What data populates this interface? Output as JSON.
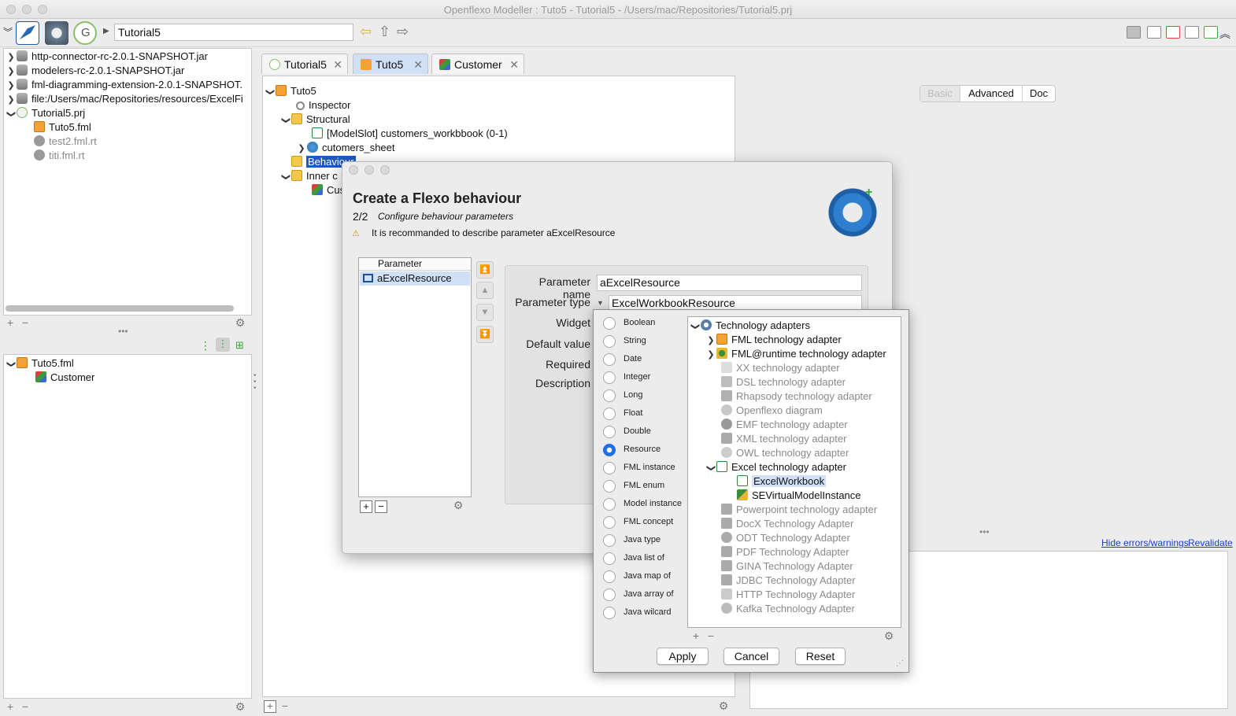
{
  "window": {
    "title": "Openflexo Modeller : Tuto5 - Tutorial5 - /Users/mac/Repositories/Tutorial5.prj"
  },
  "toolbar": {
    "path_value": "Tutorial5"
  },
  "left_tree": {
    "items": [
      {
        "label": "http-connector-rc-2.0.1-SNAPSHOT.jar"
      },
      {
        "label": "modelers-rc-2.0.1-SNAPSHOT.jar"
      },
      {
        "label": "fml-diagramming-extension-2.0.1-SNAPSHOT."
      },
      {
        "label": "file:/Users/mac/Repositories/resources/ExcelFi"
      },
      {
        "label": "Tutorial5.prj"
      },
      {
        "label": "Tuto5.fml"
      },
      {
        "label": "test2.fml.rt"
      },
      {
        "label": "titi.fml.rt"
      }
    ]
  },
  "bottom_left_tree": {
    "items": [
      {
        "label": "Tuto5.fml"
      },
      {
        "label": "Customer"
      }
    ]
  },
  "tabs": [
    {
      "label": "Tutorial5"
    },
    {
      "label": "Tuto5"
    },
    {
      "label": "Customer"
    }
  ],
  "main_tree": {
    "items": [
      {
        "label": "Tuto5"
      },
      {
        "label": "Inspector"
      },
      {
        "label": "Structural"
      },
      {
        "label": "[ModelSlot] customers_workbbook (0-1)"
      },
      {
        "label": "cutomers_sheet"
      },
      {
        "label": "Behaviour"
      },
      {
        "label": "Inner c"
      },
      {
        "label": "Cus"
      }
    ]
  },
  "inspector_tabs": {
    "basic": "Basic",
    "advanced": "Advanced",
    "doc": "Doc"
  },
  "validation": {
    "hide": "Hide errors/warnings",
    "revalidate": "Revalidate"
  },
  "dialog": {
    "title": "Create a Flexo behaviour",
    "step": "2/2",
    "step_desc": "Configure behaviour parameters",
    "warning": "It is recommanded to describe parameter aExcelResource",
    "param_header": "Parameter",
    "param_selected": "aExcelResource",
    "labels": {
      "name": "Parameter name",
      "type": "Parameter type",
      "widget": "Widget",
      "default": "Default value",
      "required": "Required",
      "description": "Description"
    },
    "name_value": "aExcelResource",
    "type_value": "ExcelWorkbookResource"
  },
  "type_popup": {
    "types": [
      "Boolean",
      "String",
      "Date",
      "Integer",
      "Long",
      "Float",
      "Double",
      "Resource",
      "FML instance",
      "FML enum",
      "Model instance",
      "FML concept",
      "Java type",
      "Java list of",
      "Java map of",
      "Java array of",
      "Java wilcard"
    ],
    "selected_index": 7,
    "tree": [
      {
        "label": "Technology adapters"
      },
      {
        "label": "FML technology adapter"
      },
      {
        "label": "FML@runtime technology adapter"
      },
      {
        "label": "XX technology adapter"
      },
      {
        "label": "DSL technology adapter"
      },
      {
        "label": "Rhapsody technology adapter"
      },
      {
        "label": "Openflexo diagram"
      },
      {
        "label": "EMF technology adapter"
      },
      {
        "label": "XML technology adapter"
      },
      {
        "label": "OWL technology adapter"
      },
      {
        "label": "Excel technology adapter"
      },
      {
        "label": "ExcelWorkbook"
      },
      {
        "label": "SEVirtualModelInstance"
      },
      {
        "label": "Powerpoint technology adapter"
      },
      {
        "label": "DocX Technology Adapter"
      },
      {
        "label": "ODT Technology Adapter"
      },
      {
        "label": "PDF Technology Adapter"
      },
      {
        "label": "GINA Technology Adapter"
      },
      {
        "label": "JDBC Technology Adapter"
      },
      {
        "label": "HTTP Technology Adapter"
      },
      {
        "label": "Kafka Technology Adapter"
      }
    ],
    "buttons": {
      "apply": "Apply",
      "cancel": "Cancel",
      "reset": "Reset"
    }
  }
}
